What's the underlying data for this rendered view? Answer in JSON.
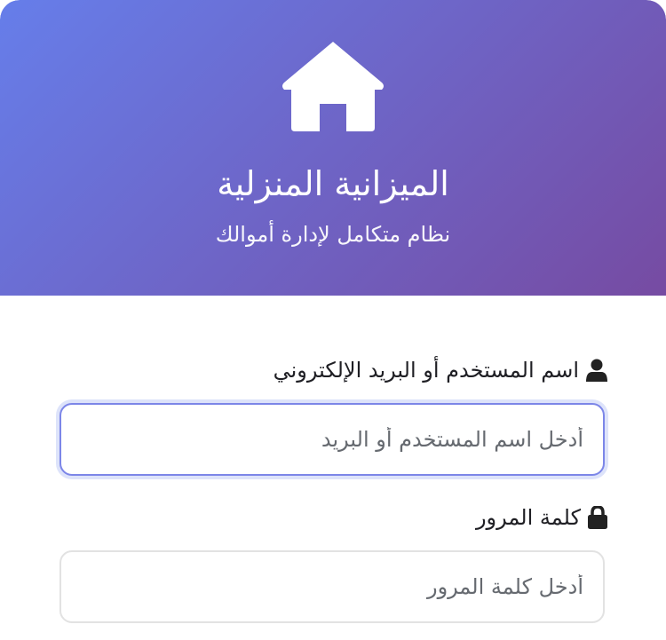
{
  "brand": {
    "title": "الميزانية المنزلية",
    "subtitle": "نظام متكامل لإدارة أموالك",
    "icon": "home-icon"
  },
  "login_form": {
    "username": {
      "label": "اسم المستخدم أو البريد الإلكتروني",
      "placeholder": "أدخل اسم المستخدم أو البريد",
      "value": "",
      "icon": "user-icon"
    },
    "password": {
      "label": "كلمة المرور",
      "placeholder": "أدخل كلمة المرور",
      "value": "",
      "icon": "lock-icon"
    }
  },
  "colors": {
    "gradient_start": "#667eea",
    "gradient_end": "#764ba2",
    "focus_border": "#7c86e8"
  }
}
